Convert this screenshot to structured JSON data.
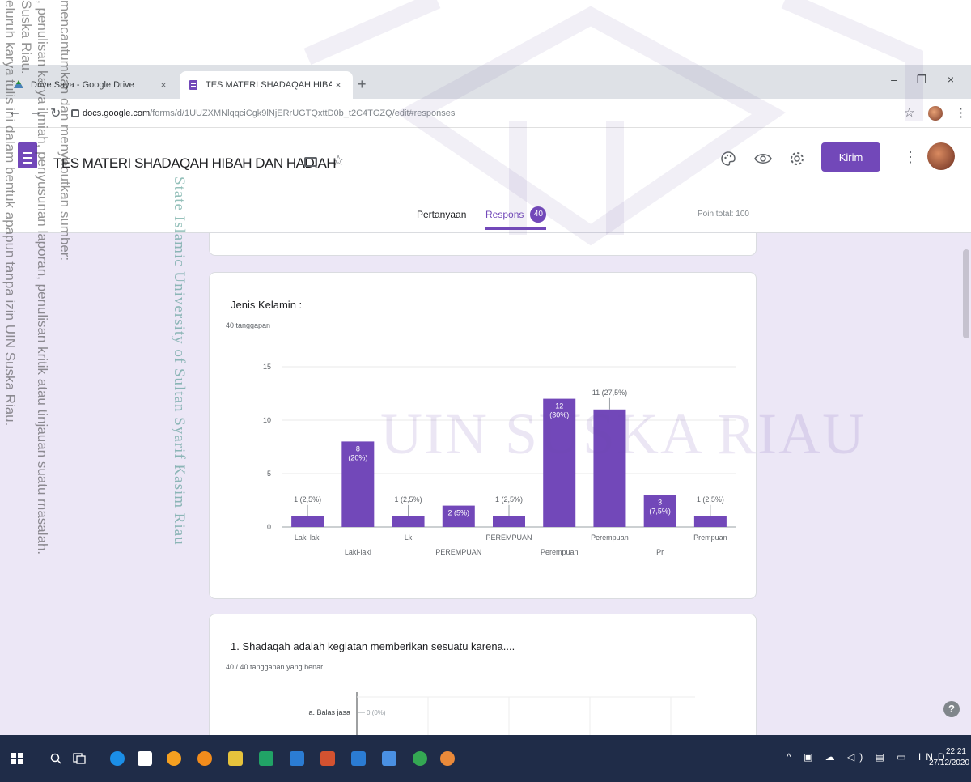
{
  "browser": {
    "tabs": [
      {
        "label": "Drive Saya - Google Drive",
        "close": "×"
      },
      {
        "label": "TES MATERI SHADAQAH HIBAH",
        "close": "×"
      }
    ],
    "new_tab": "+",
    "window_controls": {
      "minimize": "–",
      "restore": "❐",
      "close": "×"
    },
    "nav": {
      "back": "←",
      "forward": "→",
      "reload": "↻"
    },
    "url_host": "docs.google.com",
    "url_path": "/forms/d/1UUZXMNlqqciCgk9lNjERrUGTQxttD0b_t2C4TGZQ/edit#responses",
    "star": "☆",
    "menu": "⋮"
  },
  "forms": {
    "title": "TES MATERI SHADAQAH HIBAH DAN HADIAH",
    "star": "☆",
    "icons": {
      "palette": "palette-icon",
      "preview": "eye-icon",
      "settings": "gear-icon"
    },
    "send_label": "Kirim",
    "more": "⋮",
    "tab_questions": "Pertanyaan",
    "tab_responses": "Respons",
    "response_count": "40",
    "points_total": "Poin total: 100"
  },
  "question1": {
    "title": "Jenis Kelamin :",
    "count": "40 tanggapan"
  },
  "chart_data": {
    "type": "bar",
    "color": "#7248b9",
    "categories": [
      "Laki laki",
      "Laki-laki",
      "Lk",
      "PEREMPUAN",
      "PEREMPUAN",
      "Perempuan",
      "Perempuan",
      "Pr",
      "Prempuan"
    ],
    "values": [
      1,
      8,
      1,
      2,
      1,
      12,
      11,
      3,
      1
    ],
    "data_labels": [
      "1 (2,5%)",
      "8\n(20%)",
      "1 (2,5%)",
      "2 (5%)",
      "1 (2,5%)",
      "12\n(30%)",
      "11 (27,5%)",
      "3\n(7,5%)",
      "1 (2,5%)"
    ],
    "label_inside": [
      false,
      true,
      false,
      true,
      false,
      true,
      false,
      true,
      false
    ],
    "yticks": [
      0,
      5,
      10,
      15
    ],
    "ylim": [
      0,
      15
    ],
    "grid": true,
    "title": "",
    "xlabel": "",
    "ylabel": ""
  },
  "question2": {
    "title": "1. Shadaqah adalah kegiatan memberikan sesuatu karena....",
    "count": "40 / 40 tanggapan yang benar",
    "first_option": "a. Balas jasa",
    "first_value": "0 (0%)"
  },
  "help": "?",
  "taskbar": {
    "tray": "^ ▣ ☁ ◁) ▤ ▭ IND",
    "time": "22.21",
    "date": "27/12/2020"
  },
  "watermark": {
    "line1": "mencantumkan dan menyebutkan sumber:",
    "line2": ", penulisan karya ilmiah, penyusunan laporan, penulisan kritik atau tinjauan suatu masalah.",
    "line3": "Suska Riau.",
    "line4": "eluruh karya tulis ini dalam bentuk apapun tanpa izin UIN Suska Riau.",
    "university": "State Islamic University of Sultan Syarif Kasim Riau",
    "uin": "UIN SUSKA RIAU"
  }
}
